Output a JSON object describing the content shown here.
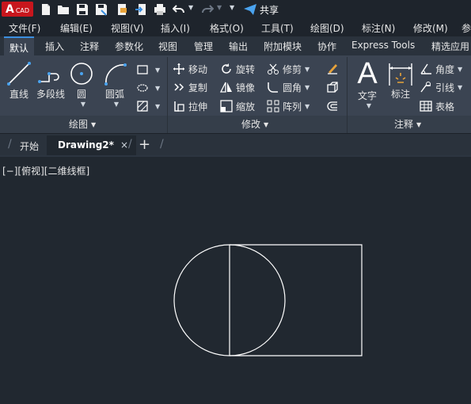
{
  "app": {
    "logo_letter": "A",
    "logo_text": "CAD",
    "share_label": "共享"
  },
  "menubar": [
    "文件(F)",
    "编辑(E)",
    "视图(V)",
    "插入(I)",
    "格式(O)",
    "工具(T)",
    "绘图(D)",
    "标注(N)",
    "修改(M)",
    "参"
  ],
  "ribbon_tabs": [
    "默认",
    "插入",
    "注释",
    "参数化",
    "视图",
    "管理",
    "输出",
    "附加模块",
    "协作",
    "Express Tools",
    "精选应用"
  ],
  "draw_panel": {
    "title": "绘图",
    "line": "直线",
    "polyline": "多段线",
    "circle": "圆",
    "arc": "圆弧"
  },
  "modify_panel": {
    "title": "修改",
    "move": "移动",
    "rotate": "旋转",
    "trim": "修剪",
    "copy": "复制",
    "mirror": "镜像",
    "fillet": "圆角",
    "stretch": "拉伸",
    "scale": "缩放",
    "array": "阵列"
  },
  "annotation_panel": {
    "title": "注释",
    "text": "文字",
    "dimension": "标注",
    "angle": "角度",
    "leader": "引线",
    "table": "表格"
  },
  "file_tabs": {
    "start": "开始",
    "drawing": "Drawing2*",
    "close": "×",
    "new": "+"
  },
  "viewport": {
    "label": "[−][俯视][二维线框]"
  },
  "colors": {
    "background": "#212830",
    "ribbon": "#3b4452",
    "accent": "#3b8fe0",
    "logo": "#c8161d",
    "geometry": "#ffffff"
  }
}
